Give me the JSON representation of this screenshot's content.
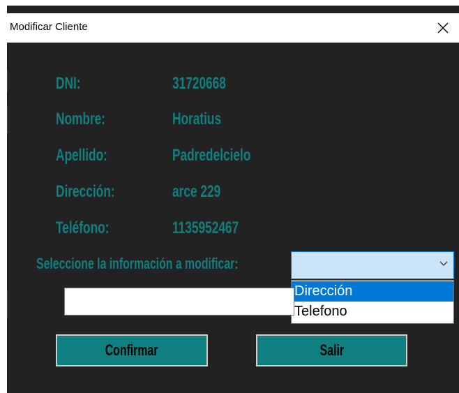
{
  "window": {
    "title": "Modificar Cliente",
    "close_icon": "close-icon"
  },
  "fields": [
    {
      "label": "DNI:",
      "value": "31720668"
    },
    {
      "label": "Nombre:",
      "value": "Horatius"
    },
    {
      "label": "Apellido:",
      "value": "Padredelcielo"
    },
    {
      "label": "Dirección:",
      "value": "arce 229"
    },
    {
      "label": "Teléfono:",
      "value": "1135952467"
    }
  ],
  "selector": {
    "prompt": "Seleccione la información a modificar:",
    "selected_value": "",
    "arrow_icon": "chevron-down-icon",
    "options": [
      "Dirección",
      "Telefono"
    ],
    "highlighted_index": 0
  },
  "new_value_input": {
    "value": ""
  },
  "buttons": {
    "confirm_label": "Confirmar",
    "exit_label": "Salir"
  },
  "colors": {
    "background": "#222222",
    "accent": "#0f7f7f",
    "highlight": "#0078d7"
  }
}
